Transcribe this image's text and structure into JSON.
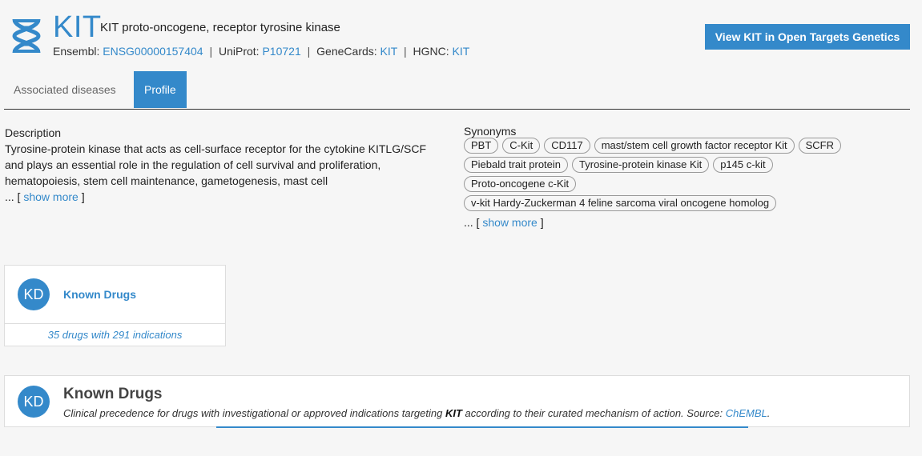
{
  "header": {
    "symbol": "KIT",
    "full_name": "KIT proto-oncogene, receptor tyrosine kinase",
    "xrefs": {
      "ensembl_label": "Ensembl:",
      "ensembl_id": "ENSG00000157404",
      "uniprot_label": "UniProt:",
      "uniprot_id": "P10721",
      "genecards_label": "GeneCards:",
      "genecards_id": "KIT",
      "hgnc_label": "HGNC:",
      "hgnc_id": "KIT",
      "separator": "|"
    },
    "cta_label": "View KIT in Open Targets Genetics",
    "icon": "dna-icon"
  },
  "tabs": [
    {
      "label": "Associated diseases",
      "active": false
    },
    {
      "label": "Profile",
      "active": true
    }
  ],
  "description": {
    "label": "Description",
    "text": "Tyrosine-protein kinase that acts as cell-surface receptor for the cytokine KITLG/SCF and plays an essential role in the regulation of cell survival and proliferation, hematopoiesis, stem cell maintenance, gametogenesis, mast cell",
    "ellipsis": "... [",
    "show_more": "show more",
    "close_bracket": "]"
  },
  "synonyms": {
    "label": "Synonyms",
    "rows": [
      [
        "PBT",
        "C-Kit",
        "CD117",
        "mast/stem cell growth factor receptor Kit",
        "SCFR"
      ],
      [
        "Piebald trait protein",
        "Tyrosine-protein kinase Kit",
        "p145 c-kit"
      ],
      [
        "Proto-oncogene c-Kit"
      ],
      [
        "v-kit Hardy-Zuckerman 4 feline sarcoma viral oncogene homolog"
      ]
    ],
    "ellipsis": "... [",
    "show_more": "show more",
    "close_bracket": "]"
  },
  "summary_card": {
    "avatar": "KD",
    "title": "Known Drugs",
    "footer": "35 drugs with 291 indications"
  },
  "section": {
    "avatar": "KD",
    "title": "Known Drugs",
    "subtitle_pre": "Clinical precedence for drugs with investigational or approved indications targeting",
    "subtitle_bold": "KIT",
    "subtitle_post": "according to their curated mechanism of action. Source:",
    "source_link": "ChEMBL",
    "subtitle_end": "."
  },
  "colors": {
    "accent": "#3489ca",
    "background": "#f6f6f6"
  }
}
